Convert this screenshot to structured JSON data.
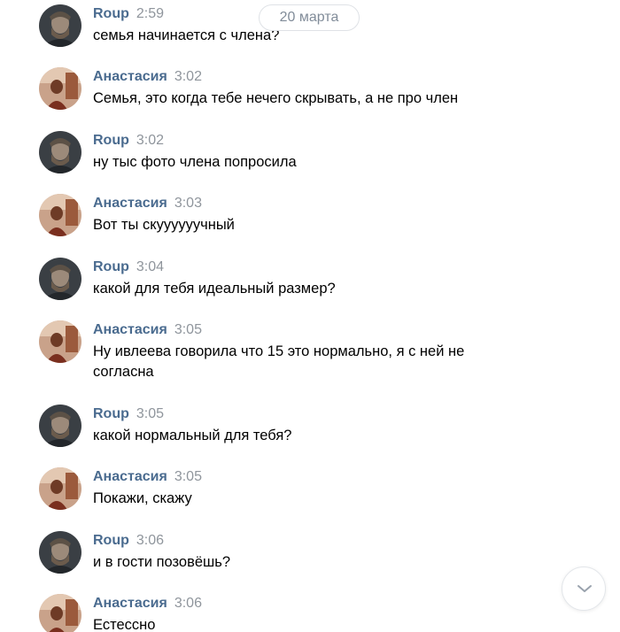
{
  "date_separator": "20 марта",
  "scroll_down_icon": "chevron-down-icon",
  "colors": {
    "author": "#4a6b8f",
    "time": "#8f959c",
    "text": "#000000"
  },
  "messages": [
    {
      "author": "Roup",
      "time": "2:59",
      "lines": [
        "семья начинается с члена?"
      ],
      "avatar": "roup"
    },
    {
      "author": "Анастасия",
      "time": "3:02",
      "lines": [
        "Семья, это когда тебе нечего скрывать, а не про член"
      ],
      "avatar": "anastasia"
    },
    {
      "author": "Roup",
      "time": "3:02",
      "lines": [
        "ну тыс фото члена попросила"
      ],
      "avatar": "roup"
    },
    {
      "author": "Анастасия",
      "time": "3:03",
      "lines": [
        "Вот ты скууууууч­ный"
      ],
      "avatar": "anastasia"
    },
    {
      "author": "Roup",
      "time": "3:04",
      "lines": [
        "какой для тебя идеальный размер?"
      ],
      "avatar": "roup"
    },
    {
      "author": "Анастасия",
      "time": "3:05",
      "lines": [
        "Ну ивлеева говорила что 15 это нормально, я с ней не",
        "согласна"
      ],
      "avatar": "anastasia"
    },
    {
      "author": "Roup",
      "time": "3:05",
      "lines": [
        "какой нормальный для тебя?"
      ],
      "avatar": "roup"
    },
    {
      "author": "Анастасия",
      "time": "3:05",
      "lines": [
        "Покажи, скажу"
      ],
      "avatar": "anastasia"
    },
    {
      "author": "Roup",
      "time": "3:06",
      "lines": [
        "и в гости позовёшь?"
      ],
      "avatar": "roup"
    },
    {
      "author": "Анастасия",
      "time": "3:06",
      "lines": [
        "Естессно"
      ],
      "avatar": "anastasia"
    }
  ]
}
